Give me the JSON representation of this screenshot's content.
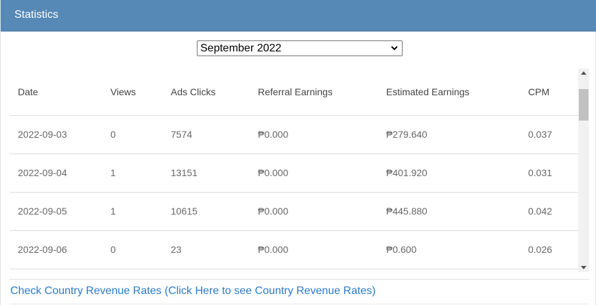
{
  "panel": {
    "title": "Statistics"
  },
  "month_select": {
    "value": "September 2022",
    "options": [
      "September 2022"
    ]
  },
  "table": {
    "headers": [
      "Date",
      "Views",
      "Ads Clicks",
      "Referral Earnings",
      "Estimated Earnings",
      "CPM"
    ],
    "rows": [
      [
        "2022-09-03",
        "0",
        "7574",
        "₱0.000",
        "₱279.640",
        "0.037"
      ],
      [
        "2022-09-04",
        "1",
        "13151",
        "₱0.000",
        "₱401.920",
        "0.031"
      ],
      [
        "2022-09-05",
        "1",
        "10615",
        "₱0.000",
        "₱445.880",
        "0.042"
      ],
      [
        "2022-09-06",
        "0",
        "23",
        "₱0.000",
        "₱0.600",
        "0.026"
      ]
    ]
  },
  "footer": {
    "rates_link": "Check Country Revenue Rates (Click Here to see Country Revenue Rates)"
  },
  "colors": {
    "header_bg": "#5689b5",
    "link": "#2b7ac9"
  },
  "icons": {
    "select_arrow": "chevron-down-icon",
    "scroll_up": "scroll-up-arrow-icon",
    "scroll_down": "scroll-down-arrow-icon"
  }
}
